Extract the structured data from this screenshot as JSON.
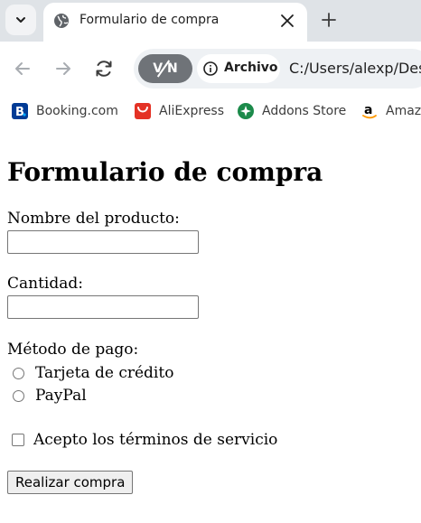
{
  "browser": {
    "tab": {
      "title": "Formulario de compra"
    },
    "toolbar": {
      "vpn_label": "V N",
      "info_label": "Archivo",
      "url": "C:/Users/alexp/Des"
    },
    "bookmarks": [
      {
        "label": "Booking.com",
        "icon": "booking-icon",
        "color": "#003b95"
      },
      {
        "label": "AliExpress",
        "icon": "aliexpress-icon",
        "color": "#e43225"
      },
      {
        "label": "Addons Store",
        "icon": "addons-store-icon",
        "color": "#1b8a4a"
      },
      {
        "label": "Amaze",
        "icon": "amazon-icon",
        "color": "#000000"
      }
    ]
  },
  "page": {
    "heading": "Formulario de compra",
    "fields": {
      "product_label": "Nombre del producto:",
      "product_value": "",
      "quantity_label": "Cantidad:",
      "quantity_value": ""
    },
    "payment": {
      "label": "Método de pago:",
      "options": [
        "Tarjeta de crédito",
        "PayPal"
      ]
    },
    "terms_label": "Acepto los términos de servicio",
    "submit_label": "Realizar compra"
  }
}
